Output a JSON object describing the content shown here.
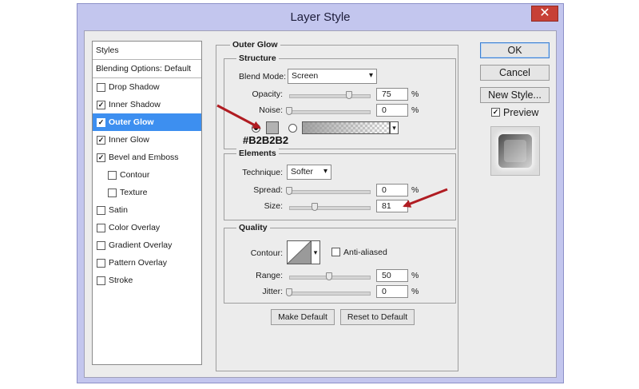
{
  "window": {
    "title": "Layer Style",
    "close_glyph": "✕"
  },
  "styles_panel": {
    "header": "Styles",
    "blending": "Blending Options: Default",
    "items": [
      {
        "label": "Drop Shadow",
        "checked": false,
        "selected": false,
        "indent": false
      },
      {
        "label": "Inner Shadow",
        "checked": true,
        "selected": false,
        "indent": false
      },
      {
        "label": "Outer Glow",
        "checked": true,
        "selected": true,
        "indent": false
      },
      {
        "label": "Inner Glow",
        "checked": true,
        "selected": false,
        "indent": false
      },
      {
        "label": "Bevel and Emboss",
        "checked": true,
        "selected": false,
        "indent": false
      },
      {
        "label": "Contour",
        "checked": false,
        "selected": false,
        "indent": true
      },
      {
        "label": "Texture",
        "checked": false,
        "selected": false,
        "indent": true
      },
      {
        "label": "Satin",
        "checked": false,
        "selected": false,
        "indent": false
      },
      {
        "label": "Color Overlay",
        "checked": false,
        "selected": false,
        "indent": false
      },
      {
        "label": "Gradient Overlay",
        "checked": false,
        "selected": false,
        "indent": false
      },
      {
        "label": "Pattern Overlay",
        "checked": false,
        "selected": false,
        "indent": false
      },
      {
        "label": "Stroke",
        "checked": false,
        "selected": false,
        "indent": false
      }
    ]
  },
  "outer_glow": {
    "title": "Outer Glow",
    "structure": {
      "title": "Structure",
      "blend_mode_label": "Blend Mode:",
      "blend_mode_value": "Screen",
      "opacity_label": "Opacity:",
      "opacity_value": "75",
      "opacity_level": 0.75,
      "noise_label": "Noise:",
      "noise_value": "0",
      "noise_level": 0,
      "pct": "%",
      "color_hex_note": "#B2B2B2",
      "glow_color": "#b2b2b2"
    },
    "elements": {
      "title": "Elements",
      "technique_label": "Technique:",
      "technique_value": "Softer",
      "spread_label": "Spread:",
      "spread_value": "0",
      "spread_level": 0,
      "size_label": "Size:",
      "size_value": "81",
      "size_level": 0.32
    },
    "quality": {
      "title": "Quality",
      "contour_label": "Contour:",
      "anti_aliased_label": "Anti-aliased",
      "anti_aliased_checked": false,
      "range_label": "Range:",
      "range_value": "50",
      "range_level": 0.5,
      "jitter_label": "Jitter:",
      "jitter_value": "0",
      "jitter_level": 0
    },
    "make_default": "Make Default",
    "reset_default": "Reset to Default"
  },
  "buttons": {
    "ok": "OK",
    "cancel": "Cancel",
    "new_style": "New Style..."
  },
  "preview": {
    "label": "Preview",
    "checked": true
  },
  "colors": {
    "selection": "#3d8ff0",
    "annotation_arrow": "#b01c22",
    "titlebar": "#c3c6ee"
  }
}
